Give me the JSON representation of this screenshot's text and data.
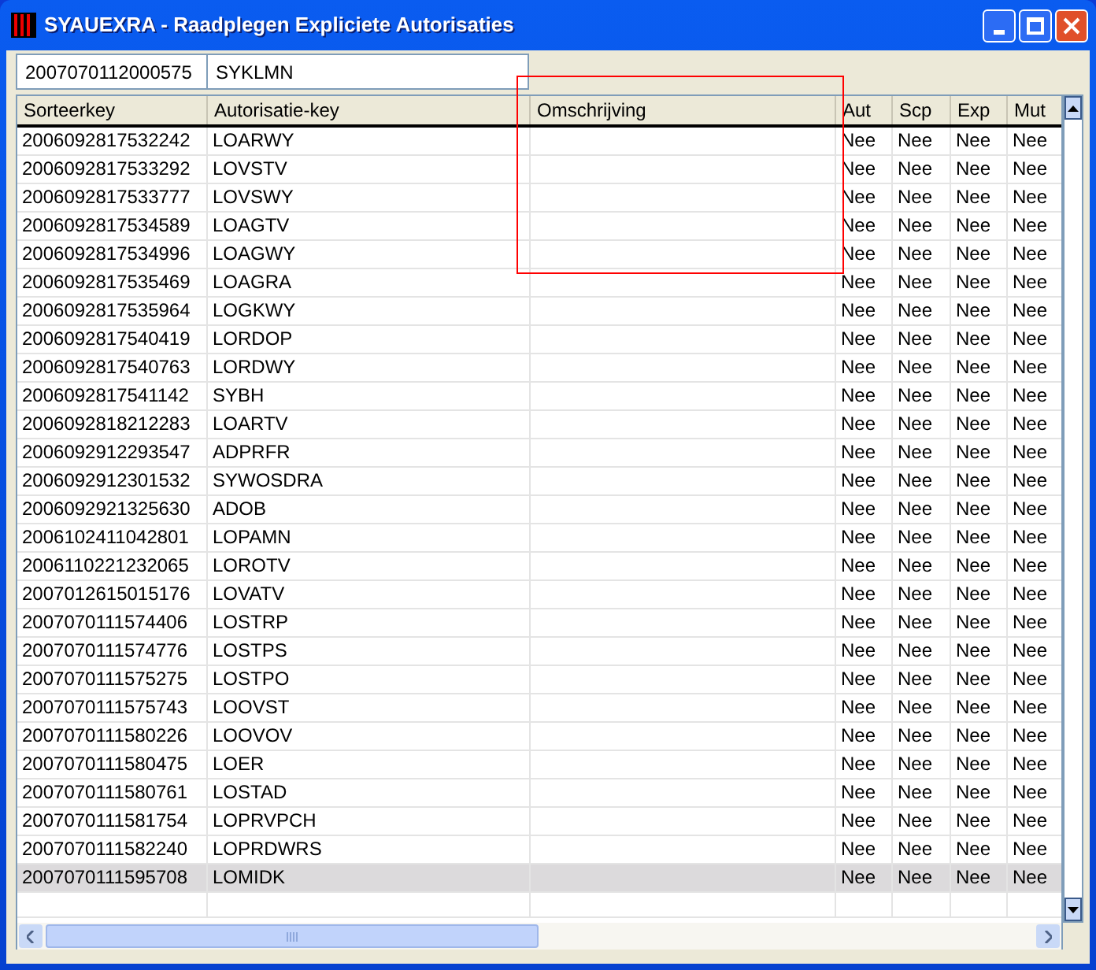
{
  "window": {
    "title": "SYAUEXRA - Raadplegen Expliciete Autorisaties"
  },
  "header_fields": [
    "2007070112000575",
    "SYKLMN"
  ],
  "table": {
    "columns": [
      "Sorteerkey",
      "Autorisatie-key",
      "Omschrijving",
      "Aut",
      "Scp",
      "Exp",
      "Mut"
    ],
    "rows": [
      {
        "sorteerkey": "2006092817532242",
        "autorisatie_key": "LOARWY",
        "aut": "Nee",
        "scp": "Nee",
        "exp": "Nee",
        "mut": "Nee",
        "selected": false
      },
      {
        "sorteerkey": "2006092817533292",
        "autorisatie_key": "LOVSTV",
        "aut": "Nee",
        "scp": "Nee",
        "exp": "Nee",
        "mut": "Nee",
        "selected": false
      },
      {
        "sorteerkey": "2006092817533777",
        "autorisatie_key": "LOVSWY",
        "aut": "Nee",
        "scp": "Nee",
        "exp": "Nee",
        "mut": "Nee",
        "selected": false
      },
      {
        "sorteerkey": "2006092817534589",
        "autorisatie_key": "LOAGTV",
        "aut": "Nee",
        "scp": "Nee",
        "exp": "Nee",
        "mut": "Nee",
        "selected": false
      },
      {
        "sorteerkey": "2006092817534996",
        "autorisatie_key": "LOAGWY",
        "aut": "Nee",
        "scp": "Nee",
        "exp": "Nee",
        "mut": "Nee",
        "selected": false
      },
      {
        "sorteerkey": "2006092817535469",
        "autorisatie_key": "LOAGRA",
        "aut": "Nee",
        "scp": "Nee",
        "exp": "Nee",
        "mut": "Nee",
        "selected": false
      },
      {
        "sorteerkey": "2006092817535964",
        "autorisatie_key": "LOGKWY",
        "aut": "Nee",
        "scp": "Nee",
        "exp": "Nee",
        "mut": "Nee",
        "selected": false
      },
      {
        "sorteerkey": "2006092817540419",
        "autorisatie_key": "LORDOP",
        "aut": "Nee",
        "scp": "Nee",
        "exp": "Nee",
        "mut": "Nee",
        "selected": false
      },
      {
        "sorteerkey": "2006092817540763",
        "autorisatie_key": "LORDWY",
        "aut": "Nee",
        "scp": "Nee",
        "exp": "Nee",
        "mut": "Nee",
        "selected": false
      },
      {
        "sorteerkey": "2006092817541142",
        "autorisatie_key": "SYBH",
        "aut": "Nee",
        "scp": "Nee",
        "exp": "Nee",
        "mut": "Nee",
        "selected": false
      },
      {
        "sorteerkey": "2006092818212283",
        "autorisatie_key": "LOARTV",
        "aut": "Nee",
        "scp": "Nee",
        "exp": "Nee",
        "mut": "Nee",
        "selected": false
      },
      {
        "sorteerkey": "2006092912293547",
        "autorisatie_key": "ADPRFR",
        "aut": "Nee",
        "scp": "Nee",
        "exp": "Nee",
        "mut": "Nee",
        "selected": false
      },
      {
        "sorteerkey": "2006092912301532",
        "autorisatie_key": "SYWOSDRA",
        "aut": "Nee",
        "scp": "Nee",
        "exp": "Nee",
        "mut": "Nee",
        "selected": false
      },
      {
        "sorteerkey": "2006092921325630",
        "autorisatie_key": "ADOB",
        "aut": "Nee",
        "scp": "Nee",
        "exp": "Nee",
        "mut": "Nee",
        "selected": false
      },
      {
        "sorteerkey": "2006102411042801",
        "autorisatie_key": "LOPAMN",
        "aut": "Nee",
        "scp": "Nee",
        "exp": "Nee",
        "mut": "Nee",
        "selected": false
      },
      {
        "sorteerkey": "2006110221232065",
        "autorisatie_key": "LOROTV",
        "aut": "Nee",
        "scp": "Nee",
        "exp": "Nee",
        "mut": "Nee",
        "selected": false
      },
      {
        "sorteerkey": "2007012615015176",
        "autorisatie_key": "LOVATV",
        "aut": "Nee",
        "scp": "Nee",
        "exp": "Nee",
        "mut": "Nee",
        "selected": false
      },
      {
        "sorteerkey": "2007070111574406",
        "autorisatie_key": "LOSTRP",
        "aut": "Nee",
        "scp": "Nee",
        "exp": "Nee",
        "mut": "Nee",
        "selected": false
      },
      {
        "sorteerkey": "2007070111574776",
        "autorisatie_key": "LOSTPS",
        "aut": "Nee",
        "scp": "Nee",
        "exp": "Nee",
        "mut": "Nee",
        "selected": false
      },
      {
        "sorteerkey": "2007070111575275",
        "autorisatie_key": "LOSTPO",
        "aut": "Nee",
        "scp": "Nee",
        "exp": "Nee",
        "mut": "Nee",
        "selected": false
      },
      {
        "sorteerkey": "2007070111575743",
        "autorisatie_key": "LOOVST",
        "aut": "Nee",
        "scp": "Nee",
        "exp": "Nee",
        "mut": "Nee",
        "selected": false
      },
      {
        "sorteerkey": "2007070111580226",
        "autorisatie_key": "LOOVOV",
        "aut": "Nee",
        "scp": "Nee",
        "exp": "Nee",
        "mut": "Nee",
        "selected": false
      },
      {
        "sorteerkey": "2007070111580475",
        "autorisatie_key": "LOER",
        "aut": "Nee",
        "scp": "Nee",
        "exp": "Nee",
        "mut": "Nee",
        "selected": false
      },
      {
        "sorteerkey": "2007070111580761",
        "autorisatie_key": "LOSTAD",
        "aut": "Nee",
        "scp": "Nee",
        "exp": "Nee",
        "mut": "Nee",
        "selected": false
      },
      {
        "sorteerkey": "2007070111581754",
        "autorisatie_key": "LOPRVPCH",
        "aut": "Nee",
        "scp": "Nee",
        "exp": "Nee",
        "mut": "Nee",
        "selected": false
      },
      {
        "sorteerkey": "2007070111582240",
        "autorisatie_key": "LOPRDWRS",
        "aut": "Nee",
        "scp": "Nee",
        "exp": "Nee",
        "mut": "Nee",
        "selected": false
      },
      {
        "sorteerkey": "2007070111595708",
        "autorisatie_key": "LOMIDK",
        "aut": "Nee",
        "scp": "Nee",
        "exp": "Nee",
        "mut": "Nee",
        "selected": true
      }
    ]
  }
}
